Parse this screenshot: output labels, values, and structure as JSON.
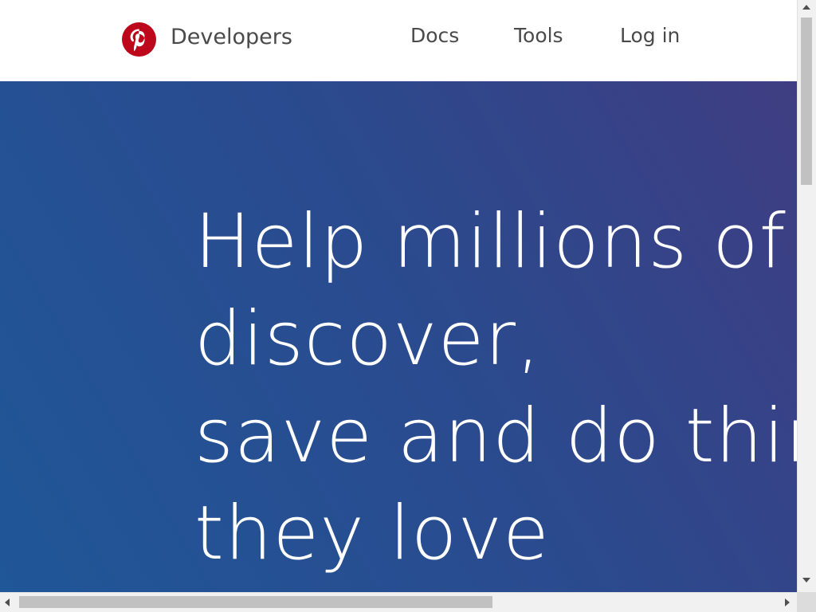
{
  "header": {
    "brand": "Developers",
    "logo_icon": "pinterest-logo-icon",
    "logo_color": "#bd081c",
    "nav": {
      "docs": "Docs",
      "tools": "Tools",
      "login": "Log in"
    }
  },
  "hero": {
    "title_lines": [
      "Help millions of",
      "discover,",
      "save and do thir",
      "they love"
    ],
    "gradient_colors": [
      "#1f5798",
      "#2b4a8e",
      "#3f3d82"
    ],
    "text_color": "#ffffff"
  },
  "scrollbars": {
    "vertical_icon_up": "scroll-up-arrow-icon",
    "vertical_icon_down": "scroll-down-arrow-icon",
    "horizontal_icon_left": "scroll-left-arrow-icon",
    "horizontal_icon_right": "scroll-right-arrow-icon"
  }
}
